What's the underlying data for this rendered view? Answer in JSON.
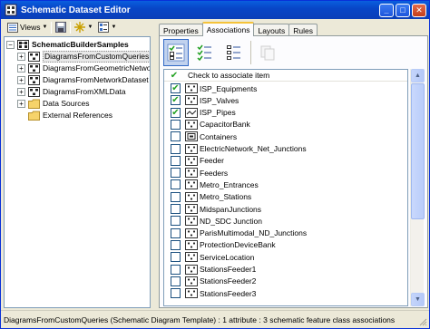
{
  "window": {
    "title": "Schematic Dataset Editor"
  },
  "toolbar": {
    "views_label": "Views"
  },
  "tree": {
    "root": "SchematicBuilderSamples",
    "items": [
      {
        "label": "DiagramsFromCustomQueries",
        "selected": true
      },
      {
        "label": "DiagramsFromGeometricNetwork",
        "selected": false
      },
      {
        "label": "DiagramsFromNetworkDataset",
        "selected": false
      },
      {
        "label": "DiagramsFromXMLData",
        "selected": false
      }
    ],
    "folders": [
      "Data Sources",
      "External References"
    ]
  },
  "tabs": [
    "Properties",
    "Associations",
    "Layouts",
    "Rules"
  ],
  "active_tab": "Associations",
  "associations": {
    "header": "Check to associate item",
    "items": [
      {
        "label": "ISP_Equipments",
        "checked": true,
        "icon": "node-icon"
      },
      {
        "label": "ISP_Valves",
        "checked": true,
        "icon": "node-icon"
      },
      {
        "label": "ISP_Pipes",
        "checked": true,
        "icon": "link-icon"
      },
      {
        "label": "CapacitorBank",
        "checked": false,
        "icon": "node-icon"
      },
      {
        "label": "Containers",
        "checked": false,
        "icon": "container-icon"
      },
      {
        "label": "ElectricNetwork_Net_Junctions",
        "checked": false,
        "icon": "node-icon"
      },
      {
        "label": "Feeder",
        "checked": false,
        "icon": "node-icon"
      },
      {
        "label": "Feeders",
        "checked": false,
        "icon": "node-icon"
      },
      {
        "label": "Metro_Entrances",
        "checked": false,
        "icon": "node-icon"
      },
      {
        "label": "Metro_Stations",
        "checked": false,
        "icon": "node-icon"
      },
      {
        "label": "MidspanJunctions",
        "checked": false,
        "icon": "node-icon"
      },
      {
        "label": "ND_SDC Junction",
        "checked": false,
        "icon": "node-icon"
      },
      {
        "label": "ParisMultimodal_ND_Junctions",
        "checked": false,
        "icon": "node-icon"
      },
      {
        "label": "ProtectionDeviceBank",
        "checked": false,
        "icon": "node-icon"
      },
      {
        "label": "ServiceLocation",
        "checked": false,
        "icon": "node-icon"
      },
      {
        "label": "StationsFeeder1",
        "checked": false,
        "icon": "node-icon"
      },
      {
        "label": "StationsFeeder2",
        "checked": false,
        "icon": "node-icon"
      },
      {
        "label": "StationsFeeder3",
        "checked": false,
        "icon": "node-icon"
      }
    ]
  },
  "status": {
    "text": "DiagramsFromCustomQueries (Schematic Diagram Template) : 1 attribute : 3 schematic feature class associations"
  }
}
